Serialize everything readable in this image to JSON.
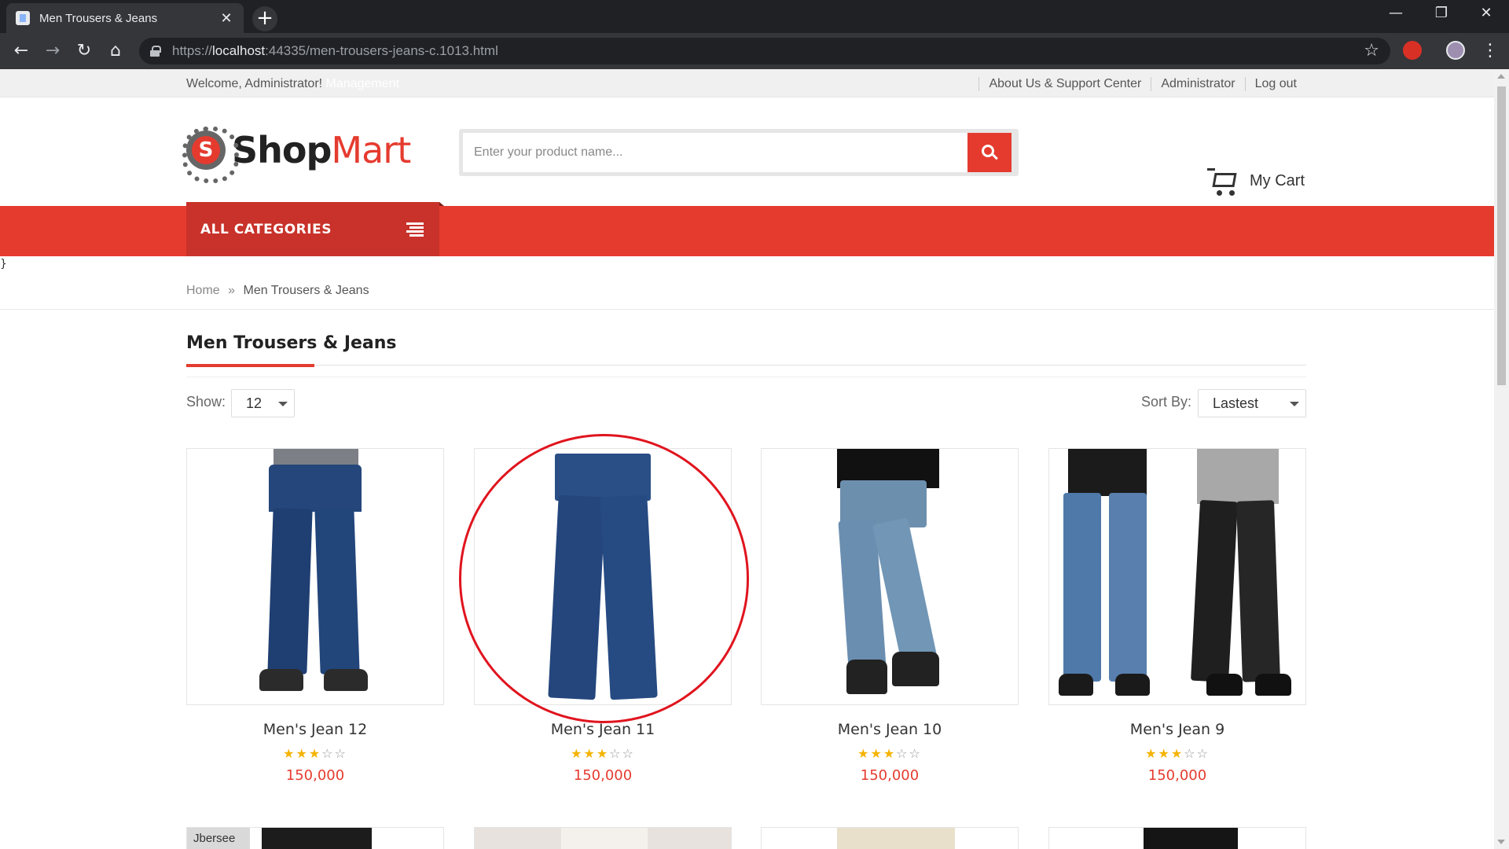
{
  "browser": {
    "tab_title": "Men Trousers & Jeans",
    "url_prefix": "https://",
    "url_host": "localhost",
    "url_rest": ":44335/men-trousers-jeans-c.1013.html"
  },
  "topbar": {
    "welcome": "Welcome, Administrator!",
    "management": "Management",
    "links": [
      "About Us & Support Center",
      "Administrator",
      "Log out"
    ]
  },
  "header": {
    "logo_letter": "S",
    "logo_shop": "Shop",
    "logo_mart": "Mart",
    "search_placeholder": "Enter your product name...",
    "cart_label": "My Cart"
  },
  "nav": {
    "all_categories": "ALL CATEGORIES"
  },
  "stray_text": "}",
  "breadcrumb": {
    "home": "Home",
    "separator": "»",
    "current": "Men Trousers & Jeans"
  },
  "category": {
    "title": "Men Trousers & Jeans",
    "show_label": "Show:",
    "show_value": "12",
    "sort_label": "Sort By:",
    "sort_value": "Lastest"
  },
  "products": [
    {
      "name": "Men's Jean 12",
      "rating": 3,
      "max_rating": 5,
      "price": "150,000"
    },
    {
      "name": "Men's Jean 11",
      "rating": 3,
      "max_rating": 5,
      "price": "150,000"
    },
    {
      "name": "Men's Jean 10",
      "rating": 3,
      "max_rating": 5,
      "price": "150,000"
    },
    {
      "name": "Men's Jean 9",
      "rating": 3,
      "max_rating": 5,
      "price": "150,000"
    }
  ],
  "bottom_row_labels": [
    "Jbersee",
    "",
    "",
    ""
  ],
  "colors": {
    "accent": "#e53b2f",
    "accent_dark": "#c8322a",
    "star": "#f5b301",
    "highlight": "#e0141e"
  }
}
